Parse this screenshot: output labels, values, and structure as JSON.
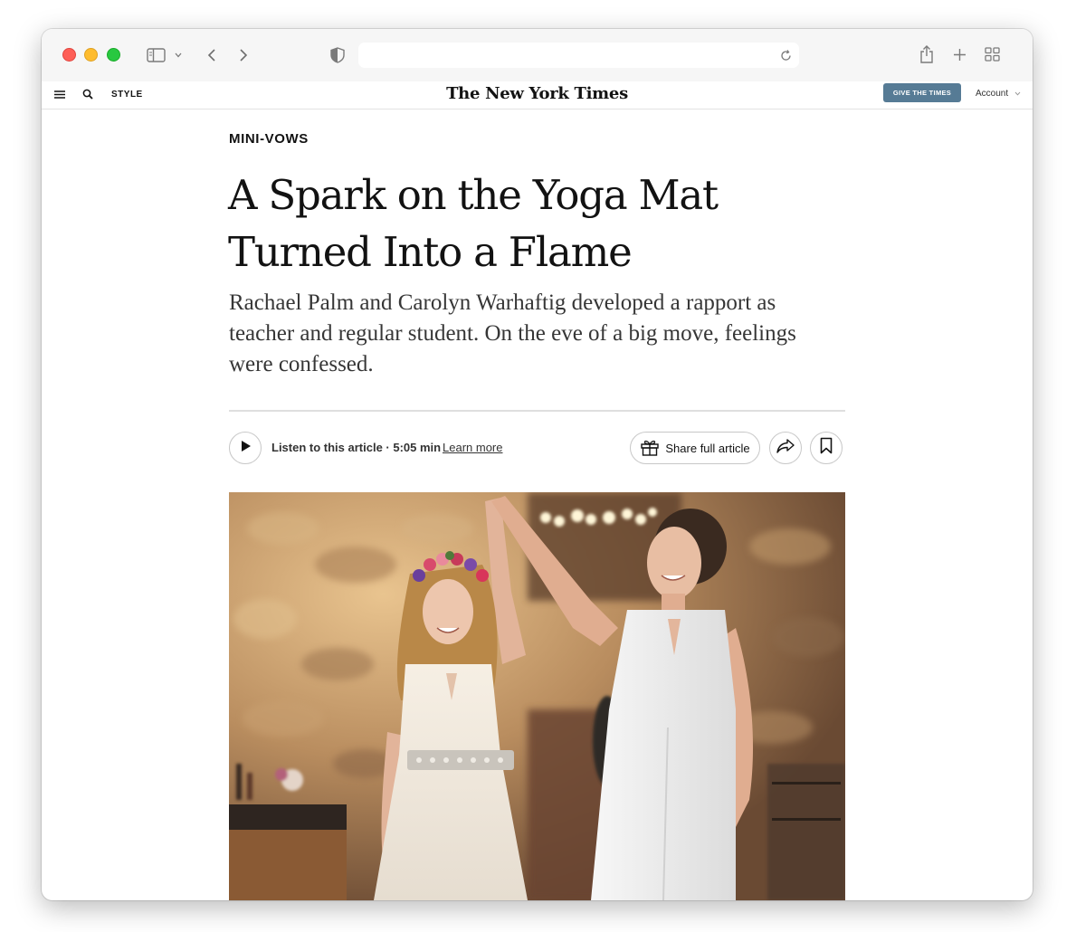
{
  "browser": {
    "icons": [
      "sidebar-icon",
      "chevron-down-icon",
      "back-icon",
      "forward-icon",
      "shield-icon",
      "reload-icon",
      "share-icon",
      "new-tab-icon",
      "tab-overview-icon"
    ],
    "address_value": ""
  },
  "masthead": {
    "section": "STYLE",
    "logo": "The New York Times",
    "give_button": "GIVE THE TIMES",
    "account": "Account",
    "accent_color": "#567b95"
  },
  "article": {
    "kicker": "MINI-VOWS",
    "headline": "A Spark on the Yoga Mat Turned Into a Flame",
    "summary": "Rachael Palm and Carolyn Warhaftig developed a rapport as teacher and regular student. On the eve of a big move, feelings were confessed.",
    "listen_label": "Listen to this article · 5:05 min",
    "learn_more": "Learn more",
    "share_full": "Share full article"
  }
}
